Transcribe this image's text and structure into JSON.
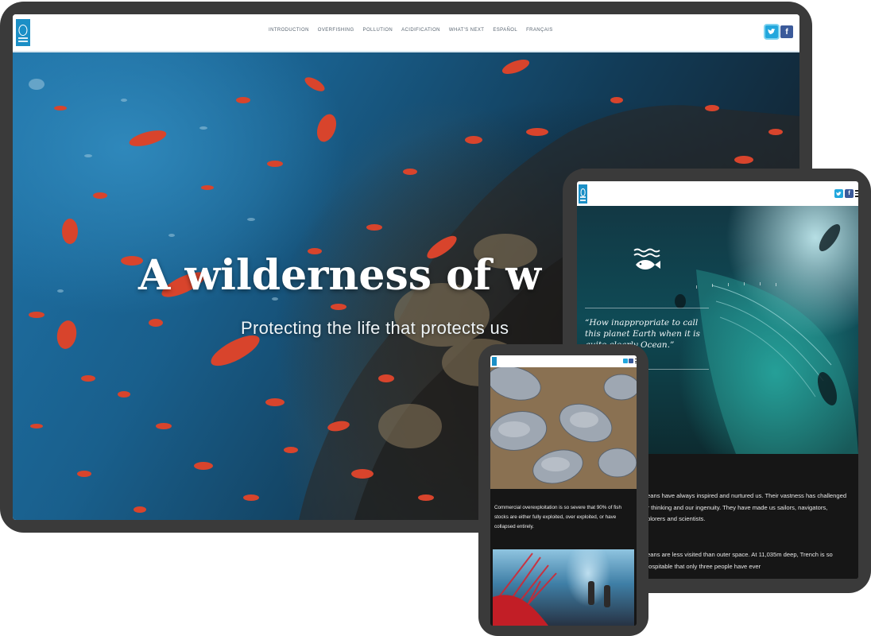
{
  "desktop": {
    "nav": {
      "items": [
        "INTRODUCTION",
        "OVERFISHING",
        "POLLUTION",
        "ACIDIFICATION",
        "WHAT'S NEXT",
        "ESPAÑOL",
        "FRANÇAIS"
      ]
    },
    "hero": {
      "title": "A wilderness of w",
      "subtitle": "Protecting the life that protects us"
    }
  },
  "tablet": {
    "quote": "“How inappropriate to call this planet Earth when it is quite clearly Ocean.”",
    "paragraphs": [
      "oceans have always inspired and nurtured us. Their vastness has challenged our thinking and our ingenuity. They have made us sailors, navigators, explorers and scientists.",
      "oceans are less visited than outer space. At 11,035m deep, Trench is so inhospitable that only three people have ever"
    ]
  },
  "phone": {
    "caption": "Commercial overexploitation is so severe that 90% of fish stocks are either fully exploited, over exploited, or have collapsed entirely."
  },
  "icons": {
    "logo": "un-emblem-icon",
    "twitter": "twitter-icon",
    "facebook": "facebook-icon",
    "menu": "hamburger-menu-icon",
    "section": "waves-fish-icon"
  },
  "colors": {
    "device_frame": "#3a3a3a",
    "un_blue": "#1b8fc6",
    "twitter": "#22a7dd",
    "facebook": "#3b5a9a",
    "fish_red": "#d8442c"
  }
}
